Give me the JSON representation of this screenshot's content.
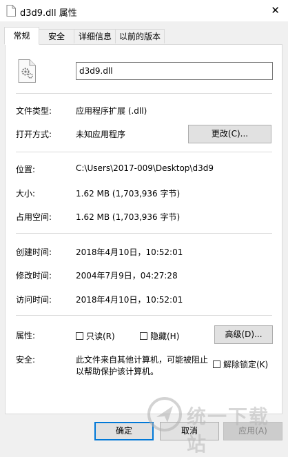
{
  "window": {
    "title": "d3d9.dll 属性",
    "close_glyph": "✕"
  },
  "tabs": [
    {
      "label": "常规",
      "active": true
    },
    {
      "label": "安全",
      "active": false
    },
    {
      "label": "详细信息",
      "active": false
    },
    {
      "label": "以前的版本",
      "active": false
    }
  ],
  "general": {
    "file_icon": "dll-gear-file-icon",
    "file_name": "d3d9.dll",
    "file_type": {
      "label": "文件类型:",
      "value": "应用程序扩展 (.dll)"
    },
    "opens_with": {
      "label": "打开方式:",
      "value": "未知应用程序",
      "change_button": "更改(C)..."
    },
    "location": {
      "label": "位置:",
      "value": "C:\\Users\\2017-009\\Desktop\\d3d9"
    },
    "size": {
      "label": "大小:",
      "value": "1.62 MB (1,703,936 字节)"
    },
    "size_on_disk": {
      "label": "占用空间:",
      "value": "1.62 MB (1,703,936 字节)"
    },
    "created": {
      "label": "创建时间:",
      "value": "2018年4月10日，10:52:01"
    },
    "modified": {
      "label": "修改时间:",
      "value": "2004年7月9日，04:27:28"
    },
    "accessed": {
      "label": "访问时间:",
      "value": "2018年4月10日，10:52:01"
    },
    "attributes": {
      "label": "属性:",
      "readonly": {
        "label": "只读(R)",
        "checked": false
      },
      "hidden": {
        "label": "隐藏(H)",
        "checked": false
      },
      "advanced_button": "高级(D)..."
    },
    "security": {
      "label": "安全:",
      "message_line1": "此文件来自其他计算机，可能被阻止",
      "message_line2": "以帮助保护该计算机。",
      "unblock": {
        "label": "解除锁定(K)",
        "checked": false
      }
    }
  },
  "footer": {
    "ok_button": "确定",
    "cancel_button": "取消",
    "apply_button": "应用(A)"
  },
  "watermark": {
    "text": "统一下载站"
  },
  "colors": {
    "accent": "#0078d7",
    "panel_bg": "#ffffff",
    "window_bg": "#f0f0f0"
  }
}
